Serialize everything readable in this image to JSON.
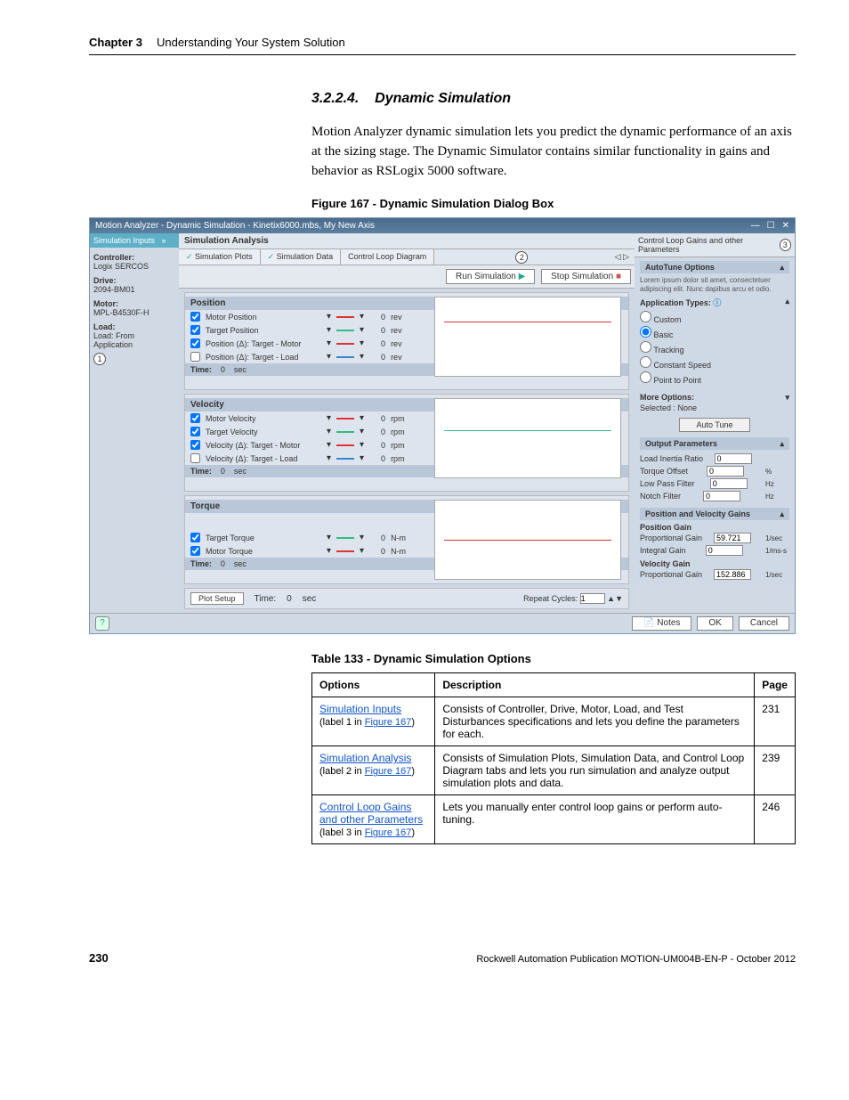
{
  "page": {
    "chapter_label": "Chapter 3",
    "chapter_title": "Understanding Your System Solution",
    "section_number": "3.2.2.4.",
    "section_title": "Dynamic Simulation",
    "body": "Motion Analyzer dynamic simulation lets you predict the dynamic performance of an axis at the sizing stage. The Dynamic Simulator contains similar functionality in gains and behavior as RSLogix 5000 software.",
    "figure_caption": "Figure 167 - Dynamic Simulation Dialog Box",
    "table_caption": "Table 133 - Dynamic Simulation Options",
    "footer_pub": "Rockwell Automation Publication MOTION-UM004B-EN-P - October 2012",
    "footer_page": "230"
  },
  "screenshot": {
    "title": "Motion Analyzer - Dynamic Simulation - Kinetix6000.mbs, My New Axis",
    "left": {
      "tab1": "Simulation Inputs",
      "controller_lbl": "Controller:",
      "controller_val": "Logix SERCOS",
      "drive_lbl": "Drive:",
      "drive_val": "2094-BM01",
      "motor_lbl": "Motor:",
      "motor_val": "MPL-B4530F-H",
      "load_lbl": "Load:",
      "load_val": "Load: From Application",
      "callout1": "1"
    },
    "center": {
      "analysis_hdr": "Simulation Analysis",
      "tabs": {
        "plots": "Simulation Plots",
        "data": "Simulation Data",
        "loop": "Control Loop Diagram"
      },
      "callout2": "2",
      "run_btn": "Run Simulation",
      "stop_btn": "Stop Simulation",
      "groups": {
        "position": {
          "title": "Position",
          "rows": [
            {
              "name": "Motor Position",
              "val": "0",
              "unit": "rev",
              "checked": true
            },
            {
              "name": "Target Position",
              "val": "0",
              "unit": "rev",
              "checked": true
            },
            {
              "name": "Position (Δ): Target - Motor",
              "val": "0",
              "unit": "rev",
              "checked": true
            },
            {
              "name": "Position (Δ): Target - Load",
              "val": "0",
              "unit": "rev",
              "checked": false
            }
          ],
          "time_lbl": "Time:",
          "time_val": "0",
          "time_unit": "sec"
        },
        "velocity": {
          "title": "Velocity",
          "rows": [
            {
              "name": "Motor Velocity",
              "val": "0",
              "unit": "rpm",
              "checked": true
            },
            {
              "name": "Target Velocity",
              "val": "0",
              "unit": "rpm",
              "checked": true
            },
            {
              "name": "Velocity (Δ): Target - Motor",
              "val": "0",
              "unit": "rpm",
              "checked": true
            },
            {
              "name": "Velocity (Δ): Target - Load",
              "val": "0",
              "unit": "rpm",
              "checked": false
            }
          ],
          "time_lbl": "Time:",
          "time_val": "0",
          "time_unit": "sec"
        },
        "torque": {
          "title": "Torque",
          "rows": [
            {
              "name": "Target Torque",
              "val": "0",
              "unit": "N-m",
              "checked": true
            },
            {
              "name": "Motor Torque",
              "val": "0",
              "unit": "N-m",
              "checked": true
            }
          ],
          "time_lbl": "Time:",
          "time_val": "0",
          "time_unit": "sec"
        }
      },
      "plot_setup_btn": "Plot Setup",
      "btm_time_lbl": "Time:",
      "btm_time_val": "0",
      "btm_time_unit": "sec",
      "repeat_lbl": "Repeat Cycles:",
      "repeat_val": "1"
    },
    "right": {
      "hdr": "Control Loop Gains and other Parameters",
      "callout3": "3",
      "autotune_hdr": "AutoTune Options",
      "lorem": "Lorem ipsum dolor sit amet, consectetuer adipiscing elit. Nunc dapibus arcu et odio.",
      "apptype_lbl": "Application Types:",
      "radios": {
        "custom": "Custom",
        "basic": "Basic",
        "tracking": "Tracking",
        "constant": "Constant Speed",
        "p2p": "Point to Point"
      },
      "more_lbl": "More Options:",
      "selected_lbl": "Selected :",
      "selected_val": "None",
      "autotune_btn": "Auto Tune",
      "out_hdr": "Output Parameters",
      "out": {
        "load_inertia": {
          "lbl": "Load Inertia Ratio",
          "val": "0",
          "u": ""
        },
        "torque_offset": {
          "lbl": "Torque Offset",
          "val": "0",
          "u": "%"
        },
        "lpf": {
          "lbl": "Low Pass Filter",
          "val": "0",
          "u": "Hz"
        },
        "notch": {
          "lbl": "Notch Filter",
          "val": "0",
          "u": "Hz"
        }
      },
      "pv_hdr": "Position and Velocity Gains",
      "pos_gain_lbl": "Position Gain",
      "pos_prop": {
        "lbl": "Proportional Gain",
        "val": "59.721",
        "u": "1/sec"
      },
      "pos_int": {
        "lbl": "Integral Gain",
        "val": "0",
        "u": "1/ms-s"
      },
      "vel_gain_lbl": "Velocity Gain",
      "vel_prop": {
        "lbl": "Proportional Gain",
        "val": "152.886",
        "u": "1/sec"
      }
    },
    "footer": {
      "notes": "Notes",
      "ok": "OK",
      "cancel": "Cancel"
    }
  },
  "options_table": {
    "headers": {
      "opt": "Options",
      "desc": "Description",
      "page": "Page"
    },
    "rows": [
      {
        "link": "Simulation Inputs",
        "sub_a": "(label 1 in ",
        "fig": "Figure 167",
        "sub_b": ")",
        "desc": "Consists of Controller, Drive, Motor, Load, and Test Disturbances specifications and lets you define the parameters for each.",
        "page": "231"
      },
      {
        "link": "Simulation Analysis",
        "sub_a": "(label 2 in ",
        "fig": "Figure 167",
        "sub_b": ")",
        "desc": "Consists of Simulation Plots, Simulation Data, and Control Loop Diagram tabs and lets you run simulation and analyze output simulation plots and data.",
        "page": "239"
      },
      {
        "link": "Control Loop Gains and other Parameters",
        "sub_a": "(label 3 in ",
        "fig": "Figure 167",
        "sub_b": ")",
        "desc": "Lets you manually enter control loop gains or perform auto-tuning.",
        "page": "246"
      }
    ]
  }
}
